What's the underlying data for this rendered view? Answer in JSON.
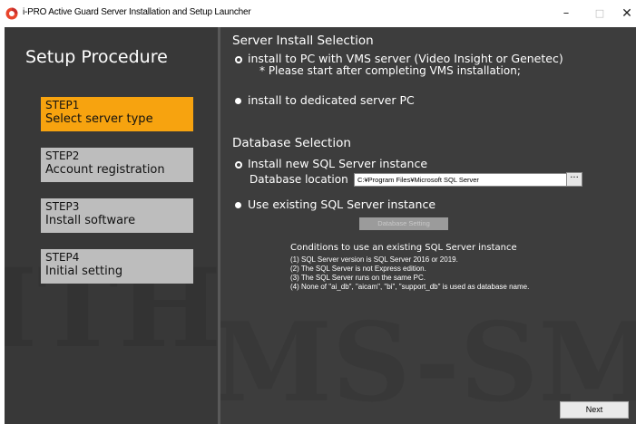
{
  "window": {
    "title": "i-PRO Active Guard Server Installation and Setup Launcher",
    "controls": {
      "minimize": "–",
      "maximize": "□",
      "close": "✕"
    },
    "icon_color": "#e8452c"
  },
  "sidebar": {
    "heading": "Setup Procedure",
    "steps": [
      {
        "num": "STEP1",
        "label": "Select server type",
        "active": true
      },
      {
        "num": "STEP2",
        "label": "Account registration",
        "active": false
      },
      {
        "num": "STEP3",
        "label": "Install software",
        "active": false
      },
      {
        "num": "STEP4",
        "label": "Initial setting",
        "active": false
      }
    ]
  },
  "server_install": {
    "title": "Server Install Selection",
    "option_vms": "install to PC with VMS server (Video Insight or Genetec)",
    "option_vms_note": "* Please start after completing VMS installation;",
    "option_dedicated": "install to dedicated server PC"
  },
  "database": {
    "title": "Database Selection",
    "option_new": "Install new SQL Server instance",
    "location_label": "Database location",
    "location_value": "C:¥Program Files¥Microsoft SQL Server",
    "browse_label": "···",
    "option_existing": "Use existing SQL Server instance",
    "setting_button": "Database Setting",
    "conditions_title": "Conditions to use an existing SQL Server instance",
    "conditions": [
      "(1) SQL Server version is SQL Server 2016 or 2019.",
      "(2) The SQL Server is not Express edition.",
      "(3) The SQL Server runs on the same PC.",
      "(4) None of \"ai_db\", \"aicam\", \"bi\", \"support_db\" is used as database name."
    ]
  },
  "footer": {
    "next_label": "Next"
  },
  "colors": {
    "accent": "#f7a30f",
    "step_inactive": "#bdbdbd",
    "panel_left": "#383838",
    "panel_right": "#3d3d3d"
  }
}
